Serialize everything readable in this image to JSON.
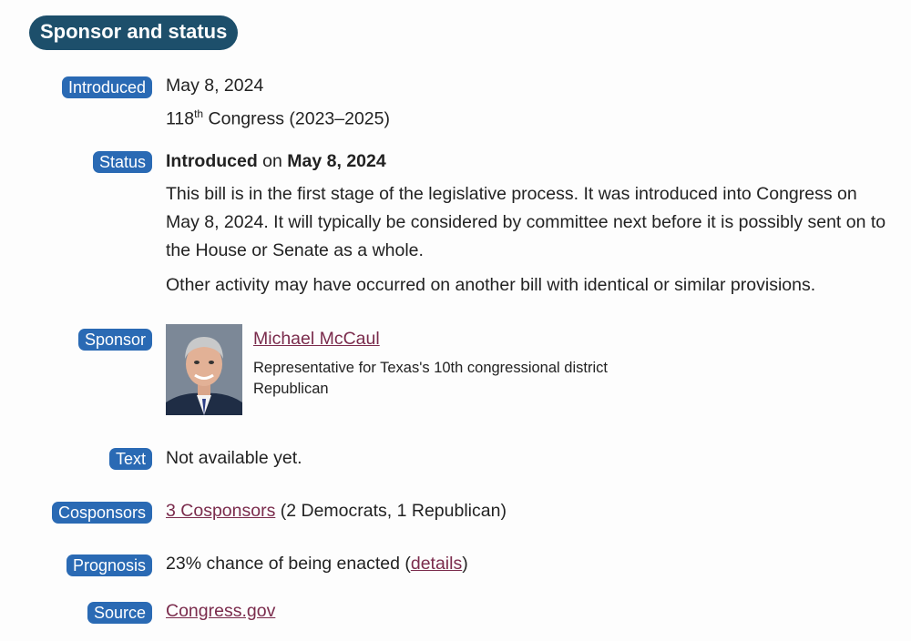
{
  "section_title": "Sponsor and status",
  "introduced": {
    "label": "Introduced",
    "date": "May 8, 2024",
    "congress_num": "118",
    "congress_sup": "th",
    "congress_rest": " Congress (2023–2025)"
  },
  "status": {
    "label": "Status",
    "line_strong1": "Introduced",
    "line_mid": " on ",
    "line_strong2": "May 8, 2024",
    "description": "This bill is in the first stage of the legislative process. It was introduced into Congress on May 8, 2024. It will typically be considered by committee next before it is possibly sent on to the House or Senate as a whole.",
    "other_activity": "Other activity may have occurred on another bill with identical or similar provisions."
  },
  "sponsor": {
    "label": "Sponsor",
    "name": "Michael McCaul",
    "role": "Representative for Texas's 10th congressional district",
    "party": "Republican"
  },
  "text": {
    "label": "Text",
    "value": "Not available yet."
  },
  "cosponsors": {
    "label": "Cosponsors",
    "link": "3 Cosponsors",
    "detail": " (2 Democrats, 1 Republican)"
  },
  "prognosis": {
    "label": "Prognosis",
    "text": "23% chance of being enacted (",
    "link": "details",
    "close": ")"
  },
  "source": {
    "label": "Source",
    "link": "Congress.gov"
  },
  "colors": {
    "heading_bg": "#1d4f6b",
    "badge_bg": "#2a6ab4",
    "link": "#7a2b4c"
  }
}
